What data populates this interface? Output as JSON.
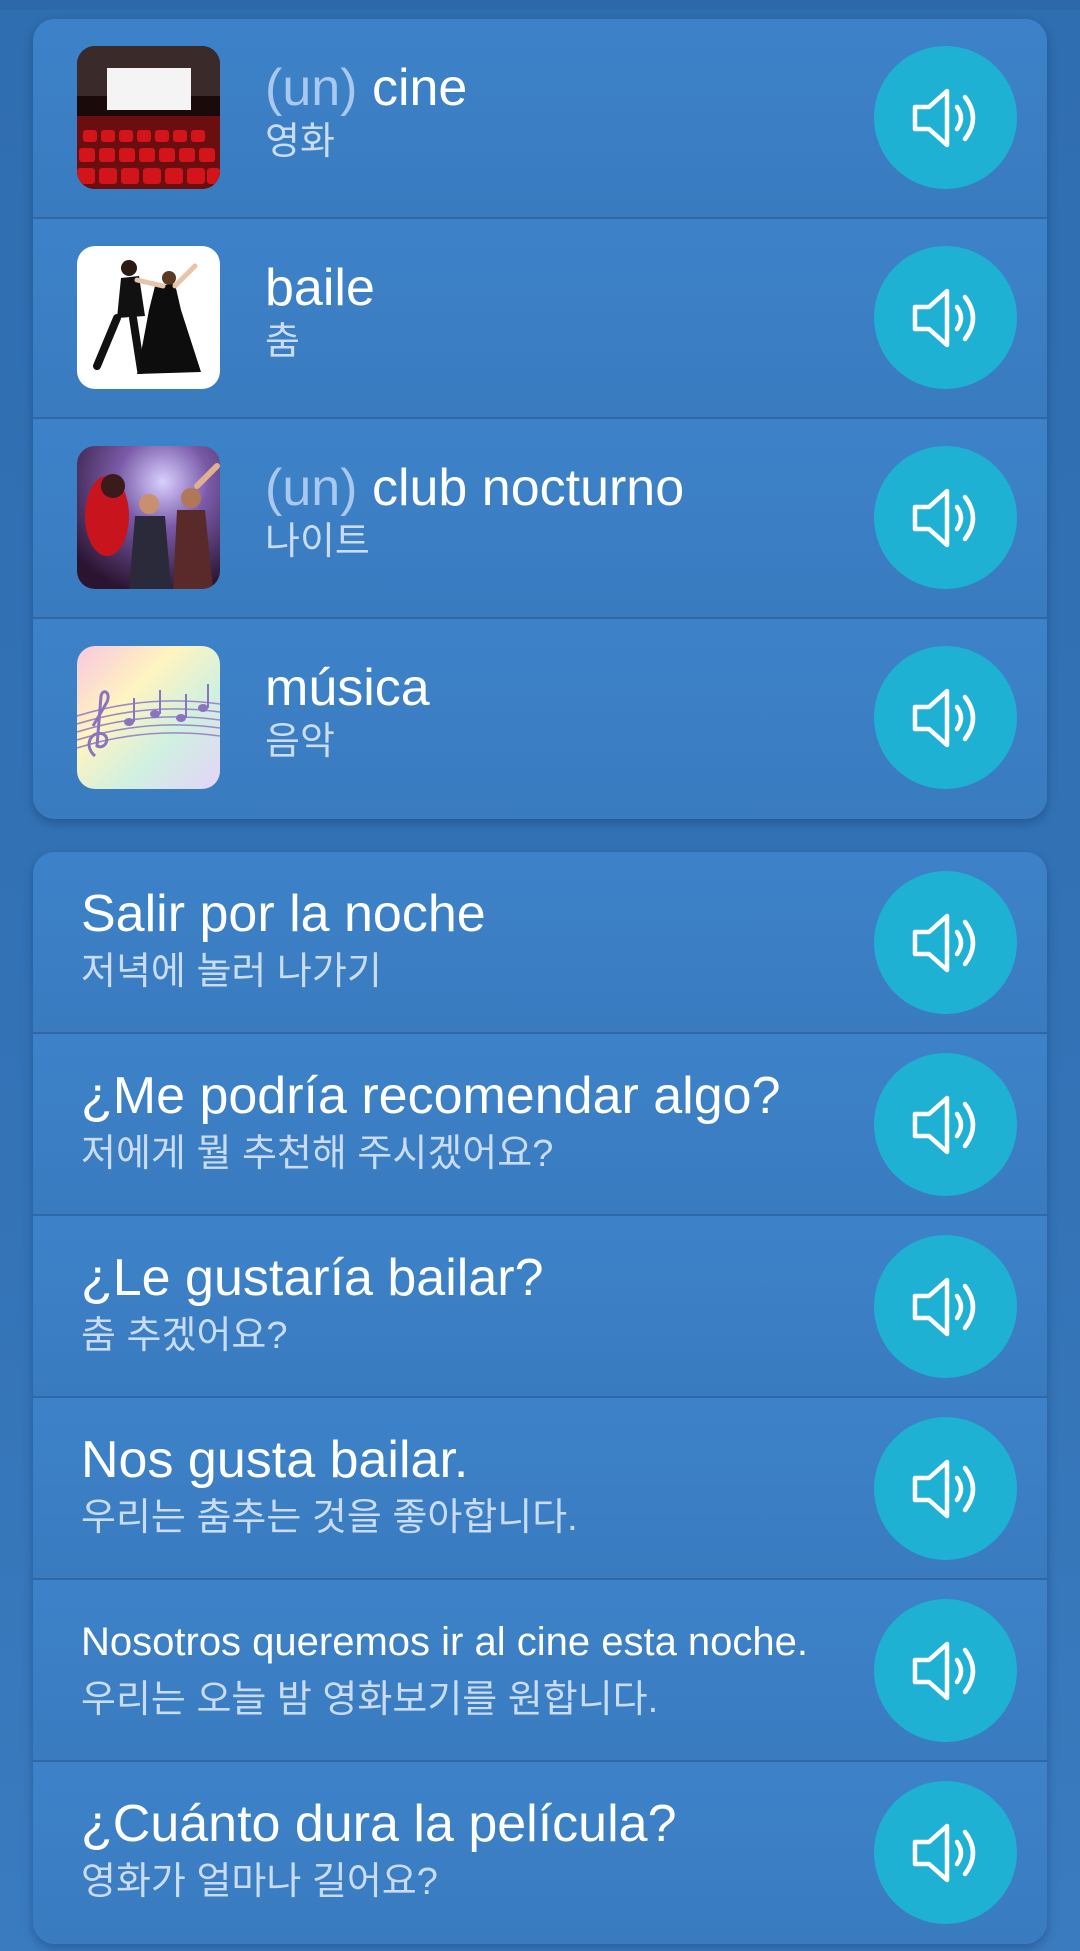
{
  "colors": {
    "background": "#3373b6",
    "card": "#3b7dc2",
    "speaker_button": "#1fb1d4",
    "article_text": "#a8c8ee",
    "translation_text": "#c9dcf3"
  },
  "vocabulary": [
    {
      "article": "(un)",
      "word": "cine",
      "translation": "영화",
      "image_icon": "cinema-image-icon"
    },
    {
      "article": "",
      "word": "baile",
      "translation": "춤",
      "image_icon": "dance-image-icon"
    },
    {
      "article": "(un)",
      "word": "club nocturno",
      "translation": "나이트",
      "image_icon": "nightclub-image-icon"
    },
    {
      "article": "",
      "word": "música",
      "translation": "음악",
      "image_icon": "music-image-icon"
    }
  ],
  "phrases": [
    {
      "text": "Salir por la noche",
      "translation": "저녁에 놀러 나가기"
    },
    {
      "text": "¿Me podría recomendar algo?",
      "translation": "저에게 뭘 추천해 주시겠어요?"
    },
    {
      "text": "¿Le gustaría bailar?",
      "translation": "춤 추겠어요?"
    },
    {
      "text": "Nos gusta bailar.",
      "translation": "우리는 춤추는 것을 좋아합니다."
    },
    {
      "text": "Nosotros queremos ir al cine esta noche.",
      "translation": "우리는 오늘 밤 영화보기를 원합니다."
    },
    {
      "text": "¿Cuánto dura la película?",
      "translation": "영화가 얼마나 길어요?"
    }
  ],
  "speaker_icon": "speaker-icon"
}
